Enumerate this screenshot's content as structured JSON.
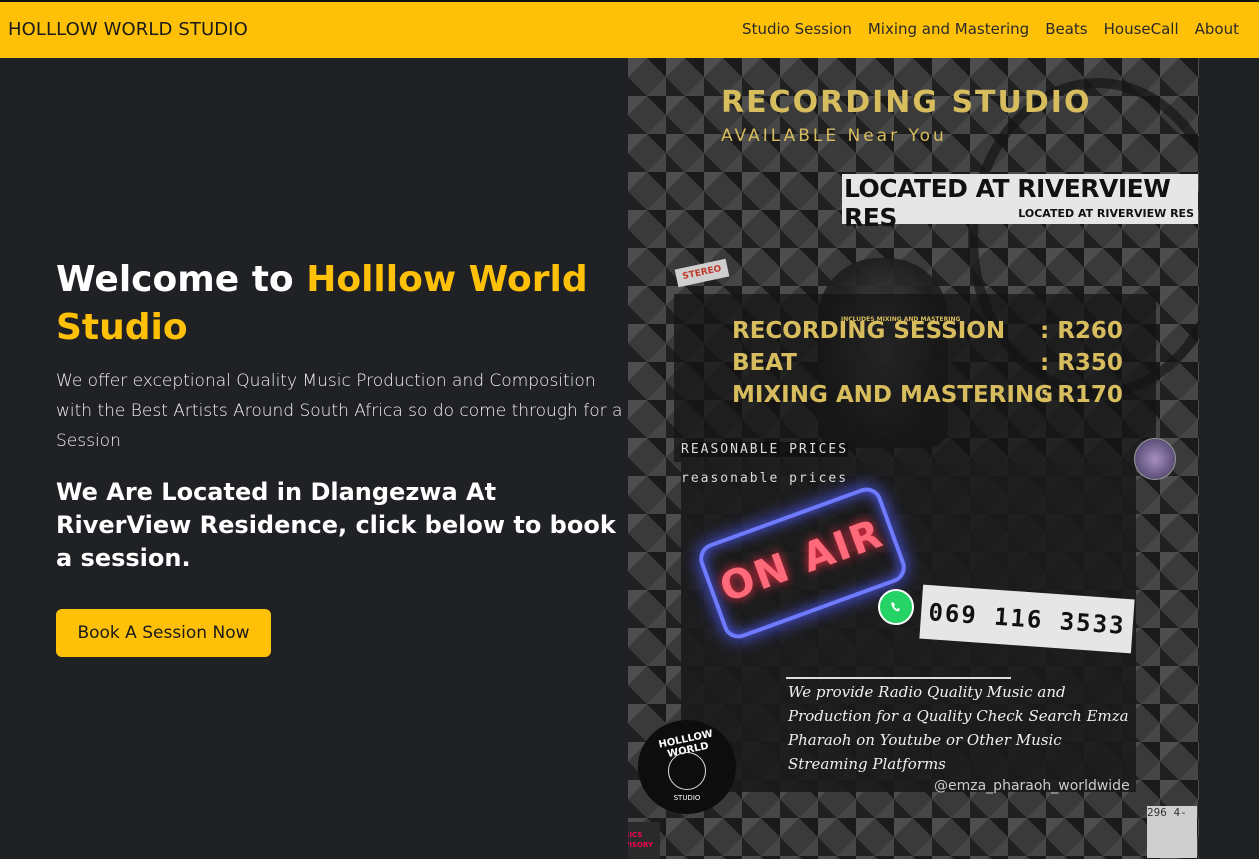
{
  "navbar": {
    "brand": "HOLLLOW WORLD STUDIO",
    "links": [
      "Studio Session",
      "Mixing and Mastering",
      "Beats",
      "HouseCall",
      "About"
    ]
  },
  "hero": {
    "title_prefix": "Welcome to ",
    "title_accent": "Holllow World Studio",
    "description": "We offer exceptional Quality Music Production and Composition with the Best Artists Around South Africa so do come through for a Session",
    "location_text": "We Are Located in Dlangezwa At RiverView Residence, click below to book a session.",
    "book_button": "Book A Session Now"
  },
  "poster": {
    "title": "RECORDING STUDIO",
    "subtitle": "AVAILABLE Near You",
    "location_big": "LOCATED AT RIVERVIEW RES",
    "location_small": "LOCATED AT RIVERVIEW RES",
    "price_note": "INCLUDES MIXING AND MASTERING",
    "prices": [
      {
        "label": "RECORDING SESSION",
        "value": ": R260"
      },
      {
        "label": "BEAT",
        "value": ": R350"
      },
      {
        "label": "MIXING AND MASTERING",
        "value": ": R170"
      }
    ],
    "reasonable_upper": "REASONABLE PRICES",
    "reasonable_lower": "reasonable prices",
    "on_air": "ON AIR",
    "phone": "069 116 3533",
    "promo": "We provide Radio Quality Music and Production for a Quality Check Search Emza Pharaoh on Youtube or Other Music Streaming Platforms",
    "handle": "@emza_pharaoh_worldwide",
    "logo_top": "HOLLLOW WORLD",
    "logo_bottom": "STUDIO",
    "sticker": "STEREO",
    "corner_left": "RICS VISORY",
    "corner_right": "296 4-"
  },
  "colors": {
    "accent": "#ffc107",
    "background": "#1f2125",
    "poster_gold": "#d8bd5e"
  }
}
